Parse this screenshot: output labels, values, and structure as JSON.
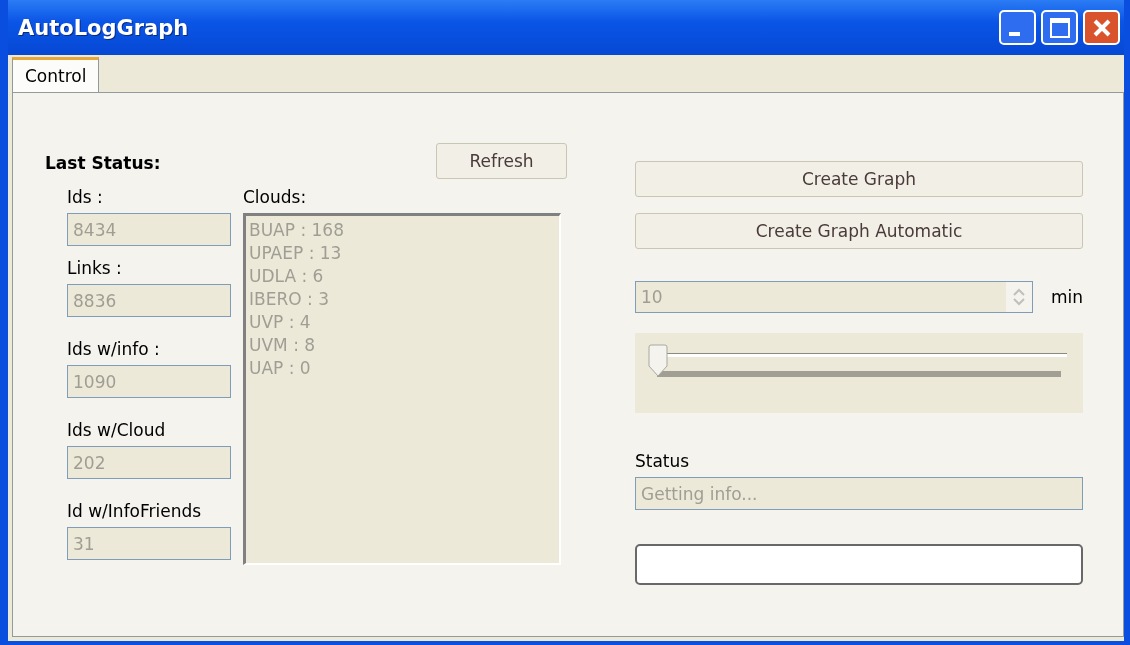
{
  "window": {
    "title": "AutoLogGraph"
  },
  "tabs": [
    {
      "label": "Control",
      "selected": true
    }
  ],
  "last_status": {
    "heading": "Last Status:",
    "refresh_button": "Refresh",
    "fields": [
      {
        "label": "Ids :",
        "value": "8434",
        "disabled": true
      },
      {
        "label": "Links :",
        "value": "8836",
        "disabled": true
      },
      {
        "label": "Ids w/info :",
        "value": "1090",
        "disabled": true
      },
      {
        "label": "Ids w/Cloud",
        "value": "202",
        "disabled": true
      },
      {
        "label": "Id w/InfoFriends",
        "value": "31",
        "disabled": true
      }
    ],
    "clouds": {
      "label": "Clouds:",
      "disabled": true,
      "items": [
        "BUAP : 168",
        "UPAEP : 13",
        "UDLA : 6",
        "IBERO : 3",
        "UVP : 4",
        "UVM : 8",
        "UAP : 0"
      ]
    }
  },
  "graph": {
    "buttons": [
      "Create Graph",
      "Create Graph Automatic"
    ],
    "interval": {
      "value": "10",
      "unit": "min",
      "disabled": true
    },
    "slider": {
      "level": 0
    },
    "status": {
      "label": "Status",
      "value": "Getting info...",
      "disabled": true
    },
    "progress": {
      "level": 0
    }
  }
}
